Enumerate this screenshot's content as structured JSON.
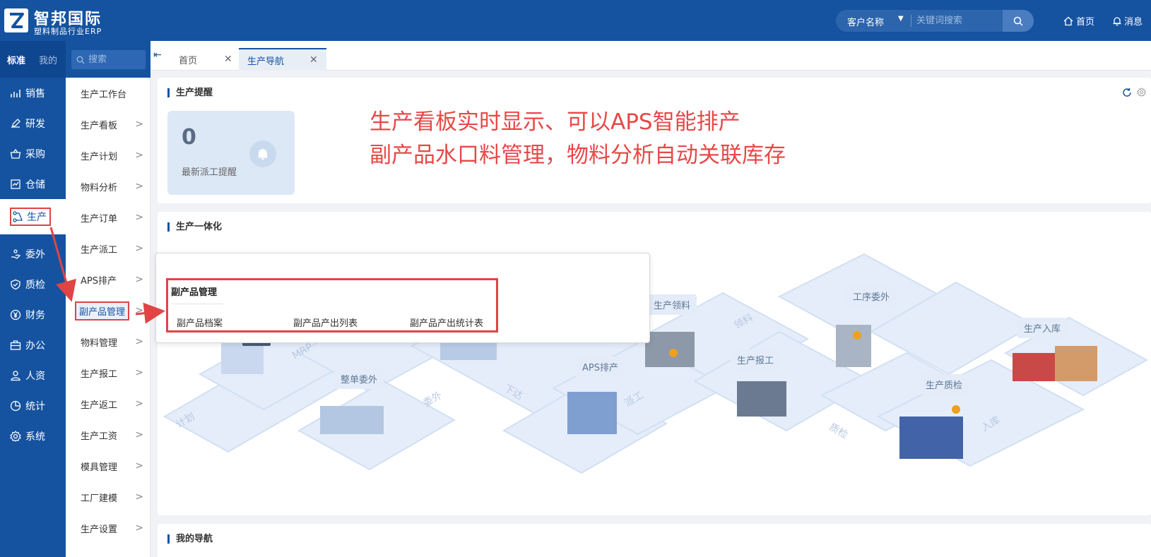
{
  "header": {
    "brand_title": "智邦国际",
    "brand_subtitle": "塑料制品行业ERP",
    "search_type": "客户名称",
    "search_placeholder": "关键词搜索",
    "nav_home": "首页",
    "nav_messages": "消息"
  },
  "sidebar": {
    "tabs": [
      "标准",
      "我的"
    ],
    "items": [
      {
        "label": "销售",
        "icon": "chart-icon"
      },
      {
        "label": "研发",
        "icon": "pen-icon"
      },
      {
        "label": "采购",
        "icon": "basket-icon"
      },
      {
        "label": "仓储",
        "icon": "warehouse-icon"
      },
      {
        "label": "生产",
        "icon": "flow-icon",
        "active": true
      },
      {
        "label": "委外",
        "icon": "hand-icon"
      },
      {
        "label": "质检",
        "icon": "shield-icon"
      },
      {
        "label": "财务",
        "icon": "yen-icon"
      },
      {
        "label": "办公",
        "icon": "briefcase-icon"
      },
      {
        "label": "人资",
        "icon": "user-icon"
      },
      {
        "label": "统计",
        "icon": "pie-icon"
      },
      {
        "label": "系统",
        "icon": "gear-icon"
      }
    ]
  },
  "submenu": {
    "search_placeholder": "搜索",
    "items": [
      {
        "label": "生产工作台",
        "has_children": false
      },
      {
        "label": "生产看板",
        "has_children": true
      },
      {
        "label": "生产计划",
        "has_children": true
      },
      {
        "label": "物料分析",
        "has_children": true
      },
      {
        "label": "生产订单",
        "has_children": true
      },
      {
        "label": "生产派工",
        "has_children": true
      },
      {
        "label": "APS排产",
        "has_children": true
      },
      {
        "label": "副产品管理",
        "has_children": true,
        "highlighted": true
      },
      {
        "label": "物料管理",
        "has_children": true
      },
      {
        "label": "生产报工",
        "has_children": true
      },
      {
        "label": "生产返工",
        "has_children": true
      },
      {
        "label": "生产工资",
        "has_children": true
      },
      {
        "label": "模具管理",
        "has_children": true
      },
      {
        "label": "工厂建模",
        "has_children": true
      },
      {
        "label": "生产设置",
        "has_children": true
      }
    ]
  },
  "tabs": [
    {
      "label": "首页",
      "active": false
    },
    {
      "label": "生产导航",
      "active": true
    }
  ],
  "reminder_card": {
    "title": "生产提醒",
    "count": "0",
    "label": "最新派工提醒"
  },
  "annotation": {
    "line1": "生产看板实时显示、可以APS智能排产",
    "line2": "副产品水口料管理，物料分析自动关联库存"
  },
  "flow_card": {
    "title": "生产一体化",
    "stations": [
      "整单委外",
      "APS排产",
      "生产领料",
      "生产报工",
      "工序委外",
      "生产质检",
      "生产入库"
    ],
    "path_labels": [
      "计划",
      "MRP",
      "委外",
      "下达",
      "派工",
      "领料",
      "质检",
      "入库"
    ]
  },
  "popup": {
    "title": "副产品管理",
    "links": [
      "副产品档案",
      "副产品产出列表",
      "副产品产出统计表"
    ]
  },
  "nav_card": {
    "title": "我的导航"
  },
  "colors": {
    "brand_blue": "#1553a1",
    "annotation_red": "#e84848",
    "highlight_red": "#e04444"
  }
}
